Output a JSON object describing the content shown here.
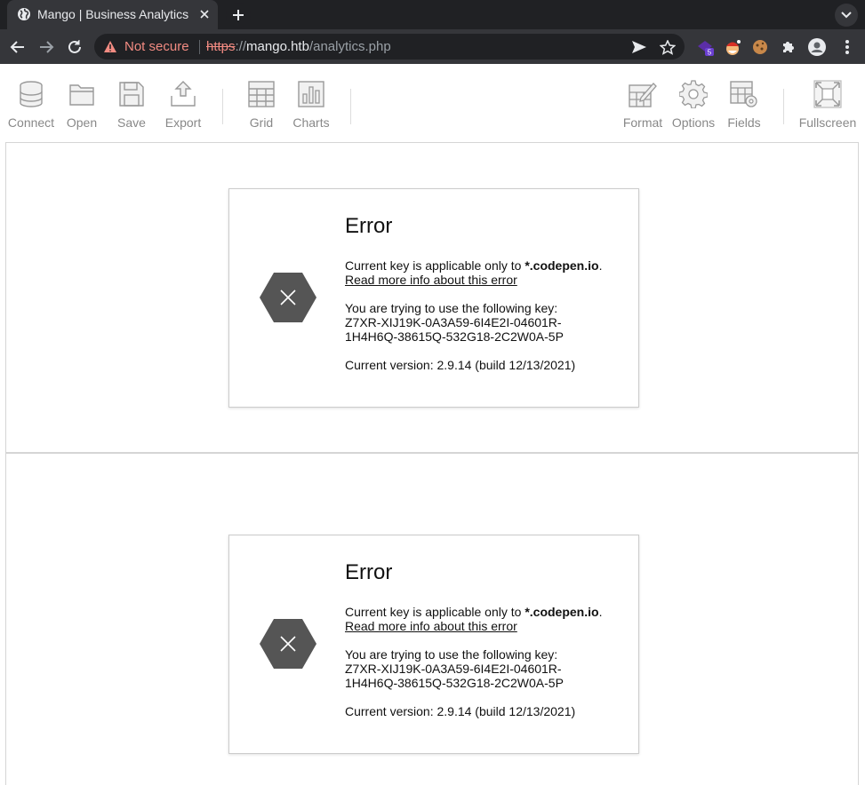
{
  "browser": {
    "tab_title": "Mango | Business Analytics",
    "security_label": "Not secure",
    "url_protocol": "https",
    "url_separator": "://",
    "url_host": "mango.htb",
    "url_path": "/analytics.php",
    "extension_badge": "5"
  },
  "toolbar": {
    "left": [
      {
        "label": "Connect",
        "icon": "database-icon"
      },
      {
        "label": "Open",
        "icon": "folder-icon"
      },
      {
        "label": "Save",
        "icon": "floppy-icon"
      },
      {
        "label": "Export",
        "icon": "export-icon"
      }
    ],
    "middle": [
      {
        "label": "Grid",
        "icon": "grid-icon"
      },
      {
        "label": "Charts",
        "icon": "bar-chart-icon"
      }
    ],
    "right": [
      {
        "label": "Format",
        "icon": "format-icon"
      },
      {
        "label": "Options",
        "icon": "gear-icon"
      },
      {
        "label": "Fields",
        "icon": "fields-icon"
      },
      {
        "label": "Fullscreen",
        "icon": "fullscreen-icon"
      }
    ]
  },
  "error": {
    "title": "Error",
    "key_scope_prefix": "Current key is applicable only to ",
    "key_scope_domain": "*.codepen.io",
    "key_scope_suffix": ".",
    "read_more_link": "Read more info about this error",
    "key_intro": "You are trying to use the following key:",
    "key_line1": "Z7XR-XIJ19K-0A3A59-6I4E2I-04601R-",
    "key_line2": "1H4H6Q-38615Q-532G18-2C2W0A-5P",
    "version": "Current version: 2.9.14 (build 12/13/2021)"
  },
  "colors": {
    "hex_icon": "#555555",
    "chrome_dark": "#202124",
    "chrome_mid": "#35363a",
    "warning": "#f28b82",
    "toolbar_icon": "#999999"
  }
}
